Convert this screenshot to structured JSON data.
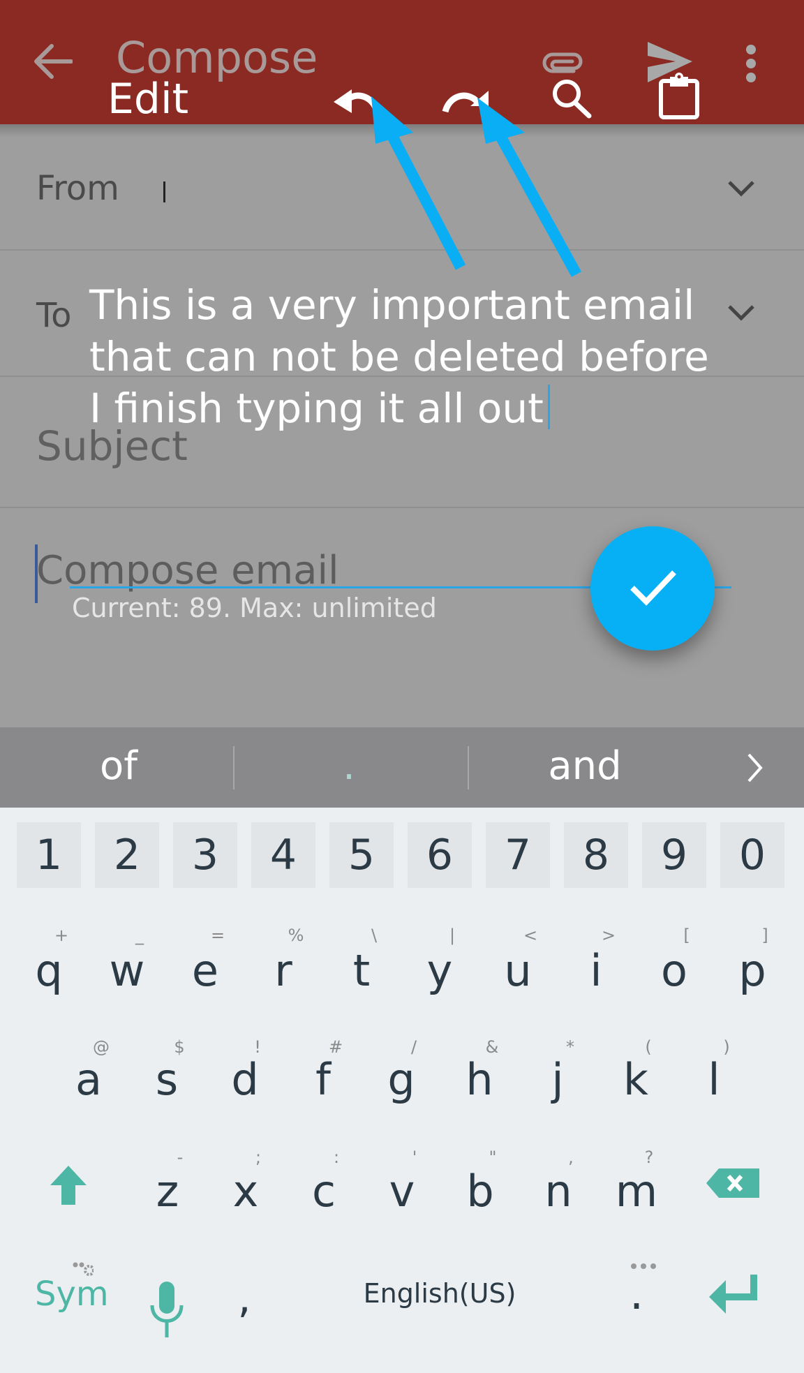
{
  "toolbar": {
    "title": "Compose",
    "mode_label": "Edit",
    "icons": [
      "back-arrow-icon",
      "undo-icon",
      "redo-icon",
      "attach-icon",
      "search-icon",
      "send-icon",
      "clipboard-icon",
      "more-vert-icon"
    ],
    "background_color": "#8a2a22"
  },
  "form": {
    "from_label": "From",
    "to_label": "To",
    "subject_placeholder": "Subject",
    "body_placeholder": "Compose email"
  },
  "overlay": {
    "input_text": "This is a very important email that can not be deleted before I finish typing it all out",
    "counter_text": "Current: 89. Max: unlimited",
    "confirm_button_icon": "check-icon",
    "accent_color": "#07b0f5"
  },
  "suggestions": {
    "words": [
      "of",
      ".",
      "and"
    ],
    "more_icon": "chevron-right-icon"
  },
  "keyboard": {
    "number_row": [
      "1",
      "2",
      "3",
      "4",
      "5",
      "6",
      "7",
      "8",
      "9",
      "0"
    ],
    "row1": [
      {
        "key": "q",
        "hint": "+"
      },
      {
        "key": "w",
        "hint": "_"
      },
      {
        "key": "e",
        "hint": "="
      },
      {
        "key": "r",
        "hint": "%"
      },
      {
        "key": "t",
        "hint": "\\"
      },
      {
        "key": "y",
        "hint": "|"
      },
      {
        "key": "u",
        "hint": "<"
      },
      {
        "key": "i",
        "hint": ">"
      },
      {
        "key": "o",
        "hint": "["
      },
      {
        "key": "p",
        "hint": "]"
      }
    ],
    "row2": [
      {
        "key": "a",
        "hint": "@"
      },
      {
        "key": "s",
        "hint": "$"
      },
      {
        "key": "d",
        "hint": "!"
      },
      {
        "key": "f",
        "hint": "#"
      },
      {
        "key": "g",
        "hint": "/"
      },
      {
        "key": "h",
        "hint": "&"
      },
      {
        "key": "j",
        "hint": "*"
      },
      {
        "key": "k",
        "hint": "("
      },
      {
        "key": "l",
        "hint": ")"
      }
    ],
    "row3": [
      {
        "key": "z",
        "hint": "-"
      },
      {
        "key": "x",
        "hint": ";"
      },
      {
        "key": "c",
        "hint": ":"
      },
      {
        "key": "v",
        "hint": "'"
      },
      {
        "key": "b",
        "hint": "\""
      },
      {
        "key": "n",
        "hint": ","
      },
      {
        "key": "m",
        "hint": "?"
      }
    ],
    "sym_label": "Sym",
    "comma_label": ",",
    "space_label": "English(US)",
    "period_label": ".",
    "icons": [
      "shift-icon",
      "backspace-icon",
      "mic-icon",
      "enter-icon"
    ],
    "accent_color": "#4db6a4"
  }
}
